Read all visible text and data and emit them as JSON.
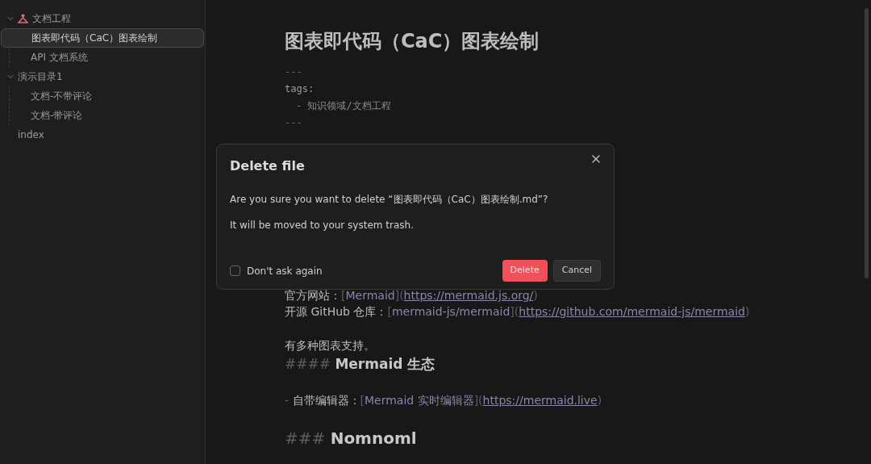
{
  "sidebar": {
    "tree": [
      {
        "label": "文档工程",
        "kind": "folder",
        "icon": true,
        "expanded": true,
        "selected": false,
        "children": [
          {
            "label": "图表即代码（CaC）图表绘制",
            "kind": "note",
            "selected": true
          },
          {
            "label": "API 文档系统",
            "kind": "note",
            "selected": false
          }
        ]
      },
      {
        "label": "演示目录1",
        "kind": "folder",
        "icon": false,
        "expanded": true,
        "selected": false,
        "children": [
          {
            "label": "文档-不带评论",
            "kind": "note",
            "selected": false
          },
          {
            "label": "文档-带评论",
            "kind": "note",
            "selected": false
          }
        ]
      },
      {
        "label": "index",
        "kind": "note",
        "selected": false
      }
    ]
  },
  "editor": {
    "title": "图表即代码（CaC）图表绘制",
    "frontmatter": [
      {
        "kind": "fence",
        "text": "---"
      },
      {
        "kind": "key",
        "text": "tags:"
      },
      {
        "kind": "item",
        "marker": "-",
        "text": "知识领域/文档工程"
      },
      {
        "kind": "fence",
        "text": "---"
      }
    ],
    "blocks": [
      {
        "kind": "line",
        "segments": [
          {
            "kind": "text",
            "text": "官方网站："
          },
          {
            "kind": "mark",
            "text": "["
          },
          {
            "kind": "link_text",
            "text": "Mermaid"
          },
          {
            "kind": "mark",
            "text": "]("
          },
          {
            "kind": "url",
            "text": "https://mermaid.js.org/"
          },
          {
            "kind": "mark",
            "text": ")"
          }
        ]
      },
      {
        "kind": "line",
        "segments": [
          {
            "kind": "text",
            "text": "开源 GitHub 仓库："
          },
          {
            "kind": "mark",
            "text": "["
          },
          {
            "kind": "link_text",
            "text": "mermaid-js/mermaid"
          },
          {
            "kind": "mark",
            "text": "]("
          },
          {
            "kind": "url",
            "text": "https://github.com/mermaid-js/mermaid"
          },
          {
            "kind": "mark",
            "text": ")"
          }
        ]
      },
      {
        "kind": "blank"
      },
      {
        "kind": "line",
        "segments": [
          {
            "kind": "text",
            "text": "有多种图表支持。"
          }
        ]
      },
      {
        "kind": "h4",
        "hashes": "####",
        "text": "Mermaid 生态"
      },
      {
        "kind": "blank"
      },
      {
        "kind": "line",
        "segments": [
          {
            "kind": "mark",
            "text": "- "
          },
          {
            "kind": "text",
            "text": "自带编辑器："
          },
          {
            "kind": "mark",
            "text": "["
          },
          {
            "kind": "link_text",
            "text": "Mermaid 实时编辑器"
          },
          {
            "kind": "mark",
            "text": "]("
          },
          {
            "kind": "url",
            "text": "https://mermaid.live"
          },
          {
            "kind": "mark",
            "text": ")"
          }
        ]
      },
      {
        "kind": "blank"
      },
      {
        "kind": "h3",
        "hashes": "###",
        "text": "Nomnoml"
      }
    ]
  },
  "dialog": {
    "title": "Delete file",
    "message": "Are you sure you want to delete “图表即代码（CaC）图表绘制.md”?",
    "note": "It will be moved to your system trash.",
    "checkbox": {
      "label": "Don't ask again",
      "checked": false
    },
    "buttons": [
      {
        "label": "Delete",
        "kind": "danger"
      },
      {
        "label": "Cancel",
        "kind": "default"
      }
    ]
  }
}
